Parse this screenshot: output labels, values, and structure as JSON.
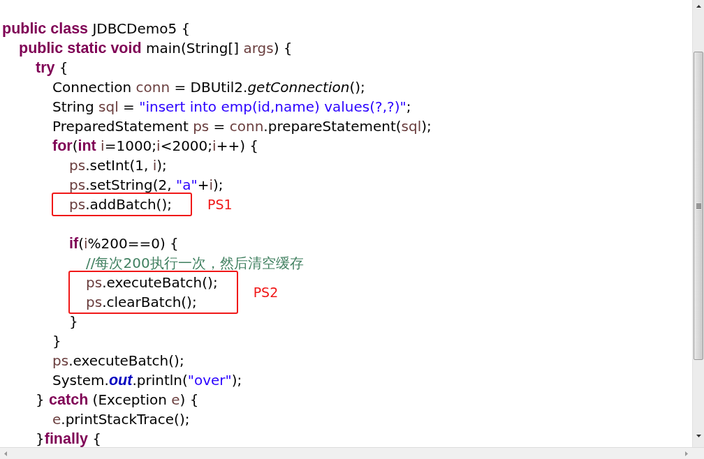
{
  "editor": {
    "lines": [
      {
        "kind": "code",
        "tokens": [
          {
            "kind": "keyword",
            "text": "public class"
          },
          {
            "kind": "plain",
            "text": " JDBCDemo5 {"
          }
        ],
        "children": [
          {
            "kind": "code",
            "tokens": [
              {
                "kind": "keyword",
                "text": "public static void"
              },
              {
                "kind": "plain",
                "text": " main(String[] "
              },
              {
                "kind": "variable",
                "text": "args"
              },
              {
                "kind": "plain",
                "text": ") {"
              }
            ],
            "children": [
              {
                "kind": "code",
                "tokens": [
                  {
                    "kind": "keyword",
                    "text": "try"
                  },
                  {
                    "kind": "plain",
                    "text": " {"
                  }
                ],
                "children": [
                  {
                    "kind": "code",
                    "tokens": [
                      {
                        "kind": "plain",
                        "text": "Connection "
                      },
                      {
                        "kind": "variable",
                        "text": "conn"
                      },
                      {
                        "kind": "plain",
                        "text": " = DBUtil2."
                      },
                      {
                        "kind": "static_call",
                        "text": "getConnection"
                      },
                      {
                        "kind": "plain",
                        "text": "();"
                      }
                    ]
                  },
                  {
                    "kind": "code",
                    "tokens": [
                      {
                        "kind": "plain",
                        "text": "String "
                      },
                      {
                        "kind": "variable",
                        "text": "sql"
                      },
                      {
                        "kind": "plain",
                        "text": " = "
                      },
                      {
                        "kind": "string",
                        "text": "\"insert into emp(id,name) values(?,?)\""
                      },
                      {
                        "kind": "plain",
                        "text": ";"
                      }
                    ]
                  },
                  {
                    "kind": "code",
                    "tokens": [
                      {
                        "kind": "plain",
                        "text": "PreparedStatement "
                      },
                      {
                        "kind": "variable",
                        "text": "ps"
                      },
                      {
                        "kind": "plain",
                        "text": " = "
                      },
                      {
                        "kind": "variable",
                        "text": "conn"
                      },
                      {
                        "kind": "plain",
                        "text": ".prepareStatement("
                      },
                      {
                        "kind": "variable",
                        "text": "sql"
                      },
                      {
                        "kind": "plain",
                        "text": ");"
                      }
                    ]
                  },
                  {
                    "kind": "code",
                    "tokens": [
                      {
                        "kind": "keyword",
                        "text": "for"
                      },
                      {
                        "kind": "plain",
                        "text": "("
                      },
                      {
                        "kind": "keyword",
                        "text": "int"
                      },
                      {
                        "kind": "variable",
                        "text": " i"
                      },
                      {
                        "kind": "plain",
                        "text": "=1000;"
                      },
                      {
                        "kind": "variable",
                        "text": "i"
                      },
                      {
                        "kind": "plain",
                        "text": "<2000;"
                      },
                      {
                        "kind": "variable",
                        "text": "i"
                      },
                      {
                        "kind": "plain",
                        "text": "++) {"
                      }
                    ],
                    "children": [
                      {
                        "kind": "code",
                        "tokens": [
                          {
                            "kind": "variable",
                            "text": "ps"
                          },
                          {
                            "kind": "plain",
                            "text": ".setInt(1, "
                          },
                          {
                            "kind": "variable",
                            "text": "i"
                          },
                          {
                            "kind": "plain",
                            "text": ");"
                          }
                        ]
                      },
                      {
                        "kind": "code",
                        "tokens": [
                          {
                            "kind": "variable",
                            "text": "ps"
                          },
                          {
                            "kind": "plain",
                            "text": ".setString(2, "
                          },
                          {
                            "kind": "string",
                            "text": "\"a\""
                          },
                          {
                            "kind": "plain",
                            "text": "+"
                          },
                          {
                            "kind": "variable",
                            "text": "i"
                          },
                          {
                            "kind": "plain",
                            "text": ");"
                          }
                        ]
                      },
                      {
                        "kind": "boxed",
                        "label": "PS1",
                        "lines": [
                          {
                            "kind": "code",
                            "tokens": [
                              {
                                "kind": "variable",
                                "text": "ps"
                              },
                              {
                                "kind": "plain",
                                "text": ".addBatch();"
                              }
                            ]
                          }
                        ]
                      },
                      {
                        "kind": "blank"
                      },
                      {
                        "kind": "code",
                        "tokens": [
                          {
                            "kind": "keyword",
                            "text": "if"
                          },
                          {
                            "kind": "plain",
                            "text": "("
                          },
                          {
                            "kind": "variable",
                            "text": "i"
                          },
                          {
                            "kind": "plain",
                            "text": "%200==0) {"
                          }
                        ],
                        "children": [
                          {
                            "kind": "comment",
                            "tokens": [
                              {
                                "kind": "comment",
                                "text": "//每次200执行一次，然后清空缓存"
                              }
                            ]
                          },
                          {
                            "kind": "boxed",
                            "label": "PS2",
                            "lines": [
                              {
                                "kind": "code",
                                "tokens": [
                                  {
                                    "kind": "variable",
                                    "text": "ps"
                                  },
                                  {
                                    "kind": "plain",
                                    "text": ".executeBatch();"
                                  }
                                ]
                              },
                              {
                                "kind": "code",
                                "tokens": [
                                  {
                                    "kind": "variable",
                                    "text": "ps"
                                  },
                                  {
                                    "kind": "plain",
                                    "text": ".clearBatch();"
                                  }
                                ]
                              }
                            ]
                          }
                        ]
                      },
                      {
                        "kind": "code",
                        "tokens": [
                          {
                            "kind": "plain",
                            "text": "}"
                          }
                        ]
                      }
                    ]
                  },
                  {
                    "kind": "code",
                    "tokens": [
                      {
                        "kind": "plain",
                        "text": "}"
                      }
                    ]
                  },
                  {
                    "kind": "code",
                    "tokens": [
                      {
                        "kind": "variable",
                        "text": "ps"
                      },
                      {
                        "kind": "plain",
                        "text": ".executeBatch();"
                      }
                    ]
                  },
                  {
                    "kind": "code",
                    "tokens": [
                      {
                        "kind": "plain",
                        "text": "System."
                      },
                      {
                        "kind": "static_field",
                        "text": "out"
                      },
                      {
                        "kind": "plain",
                        "text": ".println("
                      },
                      {
                        "kind": "string",
                        "text": "\"over\""
                      },
                      {
                        "kind": "plain",
                        "text": ");"
                      }
                    ]
                  }
                ]
              },
              {
                "kind": "code",
                "tokens": [
                  {
                    "kind": "plain",
                    "text": "} "
                  },
                  {
                    "kind": "keyword",
                    "text": "catch"
                  },
                  {
                    "kind": "plain",
                    "text": " (Exception "
                  },
                  {
                    "kind": "variable",
                    "text": "e"
                  },
                  {
                    "kind": "plain",
                    "text": ") {"
                  }
                ],
                "children": [
                  {
                    "kind": "code",
                    "tokens": [
                      {
                        "kind": "variable",
                        "text": "e"
                      },
                      {
                        "kind": "plain",
                        "text": ".printStackTrace();"
                      }
                    ]
                  }
                ]
              },
              {
                "kind": "code",
                "tokens": [
                  {
                    "kind": "plain",
                    "text": "}"
                  },
                  {
                    "kind": "keyword",
                    "text": "finally"
                  },
                  {
                    "kind": "plain",
                    "text": " {"
                  }
                ]
              }
            ]
          }
        ]
      }
    ]
  }
}
